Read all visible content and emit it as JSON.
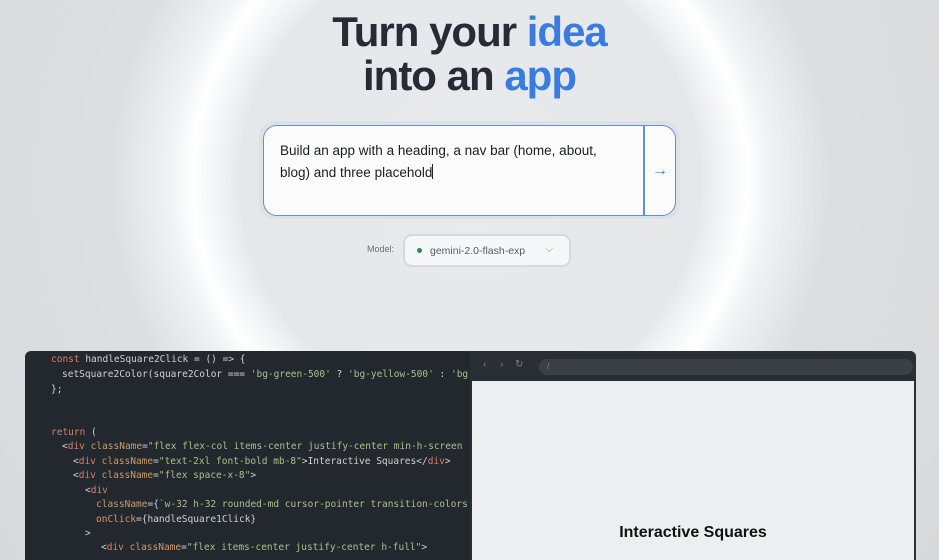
{
  "hero": {
    "line1_plain": "Turn your ",
    "line1_accent": "idea",
    "line2_plain": "into an ",
    "line2_accent": "app"
  },
  "prompt": {
    "text": "Build an app with a heading, a nav bar (home, about, blog) and three placehold",
    "send_icon": "→"
  },
  "model": {
    "label": "Model:",
    "selected": "gemini-2.0-flash-exp",
    "chevron": "⌵"
  },
  "editor": {
    "scroll_up_icon": "▲"
  },
  "browser": {
    "back_icon": "‹",
    "forward_icon": "›",
    "reload_icon": "↻",
    "url": "/",
    "preview_heading": "Interactive Squares"
  },
  "colors": {
    "accent": "#3a7be0",
    "editor_bg": "#23272e",
    "status_dot": "#2b8a57"
  }
}
